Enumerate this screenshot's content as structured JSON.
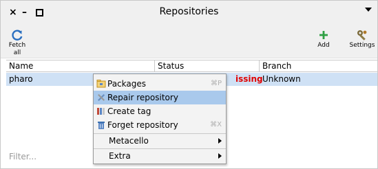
{
  "window": {
    "title": "Repositories",
    "close_glyph": "×",
    "minimize_glyph": "–"
  },
  "toolbar": {
    "fetch_all_label": "Fetch all",
    "add_label": "Add",
    "settings_label": "Settings"
  },
  "table": {
    "columns": [
      "Name",
      "Status",
      "Branch"
    ],
    "rows": [
      {
        "name": "pharo",
        "status_visible": "issing",
        "branch": "Unknown"
      }
    ],
    "filter_placeholder": "Filter..."
  },
  "context_menu": {
    "items": [
      {
        "label": "Packages",
        "shortcut": "⌘P",
        "icon": "package-icon"
      },
      {
        "label": "Repair repository",
        "shortcut": "",
        "icon": "tools-icon",
        "highlighted": true
      },
      {
        "label": "Create tag",
        "shortcut": "",
        "icon": "tag-icon"
      },
      {
        "label": "Forget repository",
        "shortcut": "⌘X",
        "icon": "trash-icon"
      },
      {
        "label": "Metacello",
        "submenu": true
      },
      {
        "label": "Extra",
        "submenu": true
      }
    ]
  },
  "colors": {
    "selection_row": "#cfe1f5",
    "menu_highlight": "#a9c9ec",
    "status_error": "#e00000",
    "fetch_icon": "#2a6fc0",
    "add_icon": "#2ea043"
  }
}
